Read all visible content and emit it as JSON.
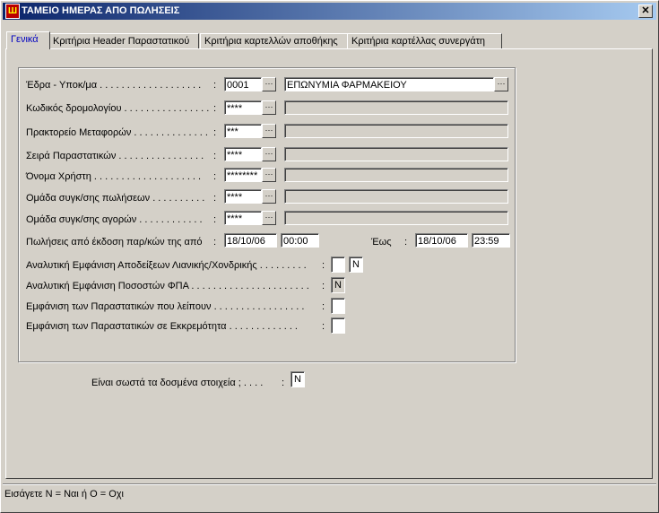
{
  "window": {
    "title": "ΤΑΜΕΙΟ ΗΜΕΡΑΣ ΑΠΟ ΠΩΛΗΣΕΙΣ",
    "icon": "app-icon",
    "close": "✕"
  },
  "tabs": [
    "Γενικά",
    "Κριτήρια Header Παραστατικού",
    "Κριτήρια καρτελλών αποθήκης",
    "Κριτήρια καρτέλλας συνεργάτη"
  ],
  "form": {
    "branch": {
      "label": "Έδρα - Υποκ/μα",
      "code": "0001",
      "name": "ΕΠΩΝΥΜΙΑ ΦΑΡΜΑΚΕΙΟΥ"
    },
    "route": {
      "label": "Κωδικός δρομολογίου",
      "code": "****"
    },
    "agency": {
      "label": "Πρακτορείο Μεταφορών",
      "code": "***"
    },
    "series": {
      "label": "Σειρά Παραστατικών",
      "code": "****"
    },
    "user": {
      "label": "Όνομα Χρήστη",
      "code": "********"
    },
    "sales_group": {
      "label": "Ομάδα συγκ/σης πωλήσεων",
      "code": "****"
    },
    "purchase_group": {
      "label": "Ομάδα συγκ/σης αγορών",
      "code": "****"
    },
    "date_from": {
      "label": "Πωλήσεις από έκδοση παρ/κών της από",
      "date": "18/10/06",
      "time": "00:00"
    },
    "date_to": {
      "label": "Έως",
      "date": "18/10/06",
      "time": "23:59"
    },
    "retail_detail": {
      "label": "Αναλυτική Εμφάνιση Αποδείξεων Λιανικής/Χονδρικής",
      "value": "",
      "value2": "Ν"
    },
    "vat_detail": {
      "label": "Αναλυτική Εμφάνιση Ποσοστών ΦΠΑ",
      "value": "Ν"
    },
    "missing_docs": {
      "label": "Εμφάνιση των Παραστατικών που λείπουν",
      "value": ""
    },
    "pending_docs": {
      "label": "Εμφάνιση των Παραστατικών σε Εκκρεμότητα",
      "value": ""
    }
  },
  "confirm": {
    "label": "Είναι σωστά τα δοσμένα στοιχεία ;",
    "value": "Ν"
  },
  "status": "Εισάγετε Ν = Ναι  ή  Ο = Οχι",
  "browse_button": "···"
}
